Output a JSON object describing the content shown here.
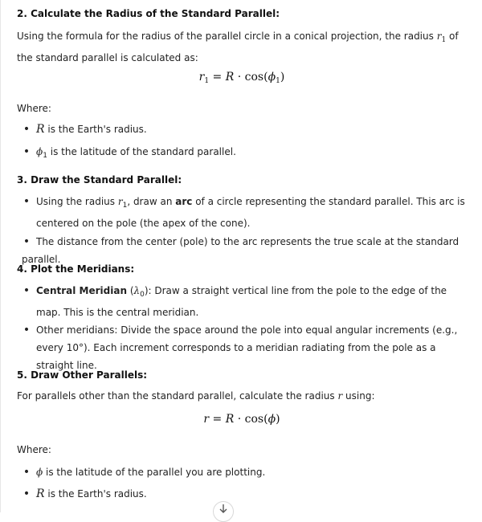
{
  "step2": {
    "heading": "2. Calculate the Radius of the Standard Parallel:",
    "intro_a": "Using the formula for the radius of the parallel circle in a conical projection, the radius ",
    "intro_var": "r",
    "intro_sub": "1",
    "intro_b": " of the standard parallel is calculated as:",
    "formula_lhs": "r",
    "formula_lhs_sub": "1",
    "formula_eq": " = ",
    "formula_R": "R",
    "formula_dot": " · ",
    "formula_cos": "cos",
    "formula_open": "(",
    "formula_phi": "ϕ",
    "formula_phi_sub": "1",
    "formula_close": ")",
    "where": "Where:",
    "bullets": [
      {
        "var": "R",
        "sub": "",
        "text": " is the Earth's radius."
      },
      {
        "var": "ϕ",
        "sub": "1",
        "text": " is the latitude of the standard parallel."
      }
    ]
  },
  "step3": {
    "heading": "3. Draw the Standard Parallel:",
    "b1_a": "Using the radius ",
    "b1_var": "r",
    "b1_sub": "1",
    "b1_b": ", draw an ",
    "b1_bold": "arc",
    "b1_c": " of a circle representing the standard parallel. This arc is centered on the pole (the apex of the cone).",
    "b2": "The distance from the center (pole) to the arc represents the true scale at the standard parallel."
  },
  "step4": {
    "heading": "4. Plot the Meridians:",
    "b1_bold": "Central Meridian",
    "b1_a": " (",
    "b1_var": "λ",
    "b1_sub": "0",
    "b1_b": "): Draw a straight vertical line from the pole to the edge of the map. This is the central meridian.",
    "b2": "Other meridians: Divide the space around the pole into equal angular increments (e.g., every 10°). Each increment corresponds to a meridian radiating from the pole as a straight line."
  },
  "step5": {
    "heading": "5. Draw Other Parallels:",
    "intro_a": "For parallels other than the standard parallel, calculate the radius ",
    "intro_var": "r",
    "intro_b": " using:",
    "formula_lhs": "r",
    "formula_eq": " = ",
    "formula_R": "R",
    "formula_dot": " · ",
    "formula_cos": "cos",
    "formula_open": "(",
    "formula_phi": "ϕ",
    "formula_close": ")",
    "where": "Where:",
    "bullets": [
      {
        "var": "ϕ",
        "text": " is the latitude of the parallel you are plotting."
      },
      {
        "var": "R",
        "text": " is the Earth's radius."
      }
    ]
  },
  "icons": {
    "scroll_down": "arrow-down-icon"
  }
}
